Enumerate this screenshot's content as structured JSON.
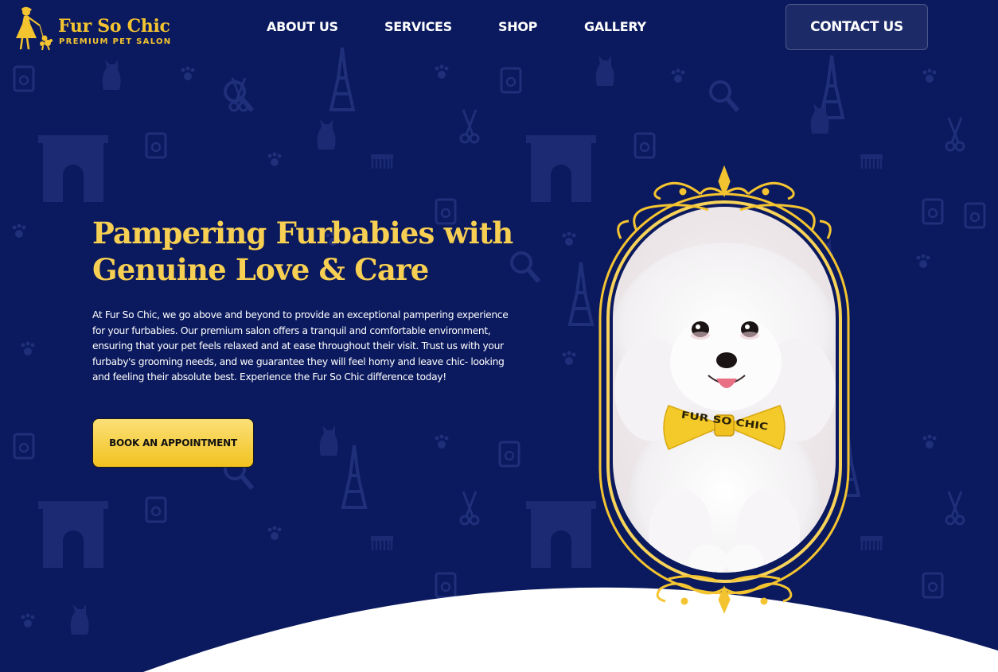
{
  "brand": {
    "name": "Fur So Chic",
    "tagline": "PREMIUM PET SALON",
    "logo_icon": "lady-with-poodle-icon"
  },
  "nav": {
    "items": [
      {
        "label": "ABOUT US"
      },
      {
        "label": "SERVICES"
      },
      {
        "label": "SHOP"
      },
      {
        "label": "GALLERY"
      }
    ],
    "contact_label": "CONTACT US"
  },
  "hero": {
    "title_line1": "Pampering Furbabies with",
    "title_line2": "Genuine Love & Care",
    "description": "At Fur So Chic, we go above and beyond to provide an exceptional pampering experience for your furbabies. Our premium salon offers a tranquil and comfortable environment, ensuring that your pet feels relaxed and at ease throughout their visit. Trust us with your furbaby's grooming needs, and we guarantee they will feel homy and leave chic- looking and feeling their absolute best. Experience the Fur So Chic difference today!",
    "cta_label": "BOOK AN APPOINTMENT",
    "image": "white-poodle-with-yellow-bow-tie",
    "bowtie_text": "FUR SO CHIC"
  },
  "colors": {
    "background": "#0b1a5e",
    "accent_gold": "#f4c430",
    "title_gold": "#f7cf52",
    "text": "#ffffff",
    "wave": "#ffffff"
  }
}
